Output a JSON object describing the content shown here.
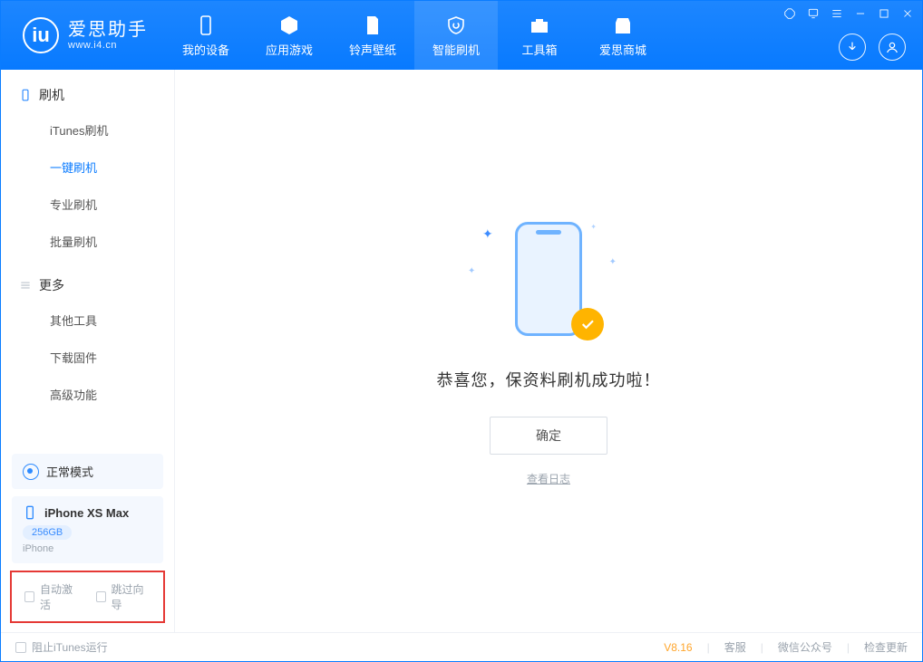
{
  "app": {
    "name_cn": "爱思助手",
    "name_en": "www.i4.cn"
  },
  "nav": [
    {
      "label": "我的设备"
    },
    {
      "label": "应用游戏"
    },
    {
      "label": "铃声壁纸"
    },
    {
      "label": "智能刷机"
    },
    {
      "label": "工具箱"
    },
    {
      "label": "爱思商城"
    }
  ],
  "sidebar": {
    "section1_title": "刷机",
    "items1": [
      {
        "label": "iTunes刷机"
      },
      {
        "label": "一键刷机"
      },
      {
        "label": "专业刷机"
      },
      {
        "label": "批量刷机"
      }
    ],
    "section2_title": "更多",
    "items2": [
      {
        "label": "其他工具"
      },
      {
        "label": "下载固件"
      },
      {
        "label": "高级功能"
      }
    ],
    "mode_label": "正常模式",
    "device": {
      "name": "iPhone XS Max",
      "capacity": "256GB",
      "type": "iPhone"
    },
    "checkbox1": "自动激活",
    "checkbox2": "跳过向导"
  },
  "main": {
    "success_text": "恭喜您，保资料刷机成功啦！",
    "ok_button": "确定",
    "view_log": "查看日志"
  },
  "footer": {
    "block_itunes": "阻止iTunes运行",
    "version": "V8.16",
    "link1": "客服",
    "link2": "微信公众号",
    "link3": "检查更新"
  }
}
